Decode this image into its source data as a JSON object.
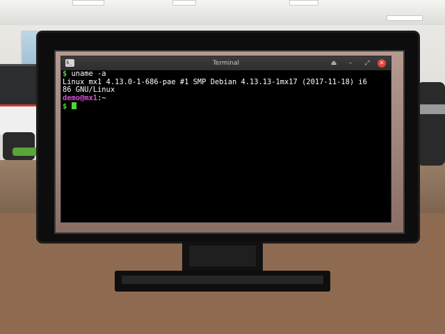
{
  "window": {
    "title": "Terminal",
    "app_icon_text": "$_",
    "buttons": {
      "shade": "⏏",
      "minimize": "–",
      "maximize": "⤢",
      "close": "✕"
    }
  },
  "terminal": {
    "prompt_symbol": "$",
    "command": " uname -a",
    "output_line1": "Linux mx1 4.13.0-1-686-pae #1 SMP Debian 4.13.13-1mx17 (2017-11-18) i6",
    "output_line2": "86 GNU/Linux",
    "user": "demo",
    "at_host": "@mx1",
    "path": ":~",
    "cursor_prompt_symbol": "$"
  },
  "colors": {
    "prompt_green": "#4dd43a",
    "user_magenta": "#d34fd3",
    "close_red": "#e0453c",
    "terminal_bg": "#000000"
  },
  "icons": {
    "app": "terminal-icon",
    "shade": "eject-icon",
    "minimize": "minimize-icon",
    "maximize": "maximize-icon",
    "close": "close-icon"
  }
}
